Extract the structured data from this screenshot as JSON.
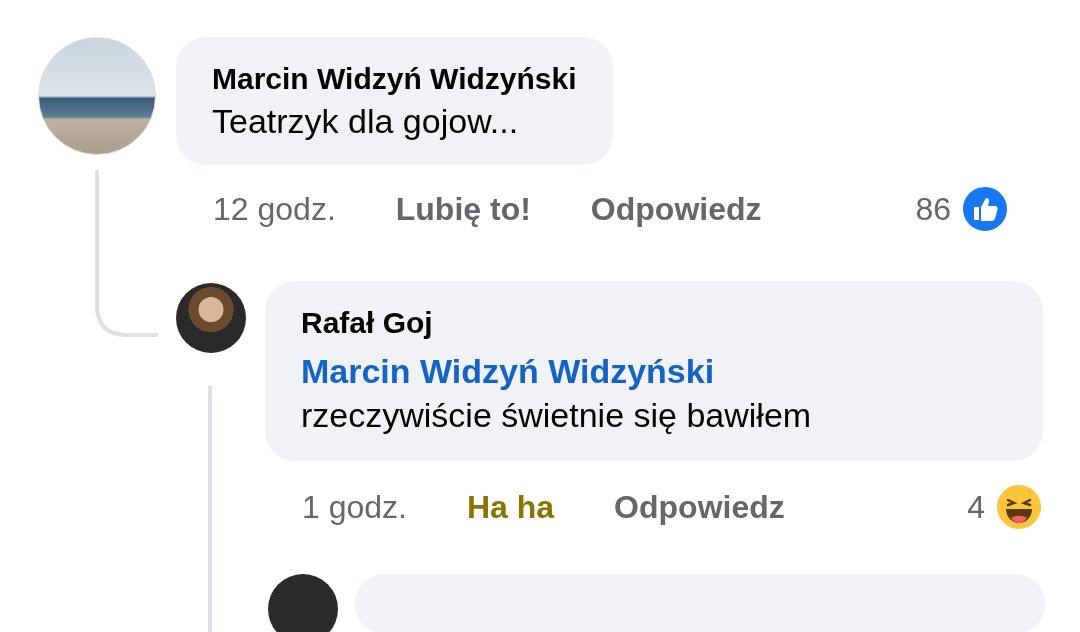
{
  "comments": [
    {
      "author": "Marcin Widzyń Widzyński",
      "text": "Teatrzyk dla gojow...",
      "time": "12 godz.",
      "reaction_label": "Lubię to!",
      "reacted": false,
      "reply_label": "Odpowiedz",
      "reaction_count": "86",
      "kind": "like",
      "replies": [
        {
          "author": "Rafał Goj",
          "mention": "Marcin Widzyń Widzyński",
          "text": "rzeczywiście świetnie się bawiłem",
          "time": "1 godz.",
          "reaction_label": "Ha ha",
          "reacted": true,
          "reply_label": "Odpowiedz",
          "reaction_count": "4",
          "kind": "haha"
        }
      ]
    }
  ]
}
